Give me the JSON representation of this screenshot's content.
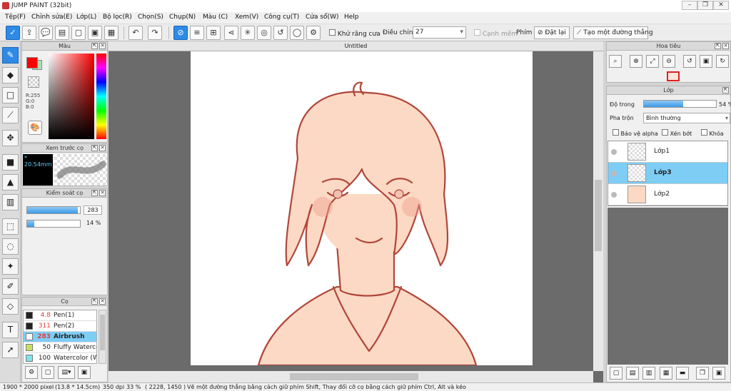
{
  "app": {
    "title": "JUMP PAINT (32bit)"
  },
  "menu": [
    "Tệp(F)",
    "Chỉnh sửa(E)",
    "Lớp(L)",
    "Bộ lọc(R)",
    "Chọn(S)",
    "Chụp(N)",
    "Màu (C)",
    "Xem(V)",
    "Công cụ(T)",
    "Cửa sổ(W)",
    "Help"
  ],
  "toolbar": {
    "antialias_label": "Khử răng cưa",
    "correction_label": "Điều chỉnh",
    "correction_value": "27",
    "edge_label": "Cạnh mềm",
    "pen_label": "Phím",
    "reset_label": "Đặt lại",
    "line_label": "Tạo một đường thẳng"
  },
  "color_panel": {
    "title": "Màu",
    "rgb": [
      "R:255",
      "G:0",
      "B:0"
    ],
    "primary": "#ff0000",
    "secondary": "#a8e0b4"
  },
  "brush_preview": {
    "title": "Xem trước cọ",
    "size": "* 20.54mm"
  },
  "brush_control": {
    "title": "Kiểm soát cọ",
    "size_value": "283",
    "size_fill": 0.96,
    "opacity_value": "14 %",
    "opacity_fill": 0.14
  },
  "brushes": {
    "title": "Cọ",
    "items": [
      {
        "size": "4.8",
        "name": "Pen(1)",
        "color": "#222222"
      },
      {
        "size": "311",
        "name": "Pen(2)",
        "color": "#222222"
      },
      {
        "size": "283",
        "name": "Airbrush",
        "color": "#ffffff",
        "selected": true
      },
      {
        "size": "50",
        "name": "Fluffy Watercolor",
        "color": "#c8e060"
      },
      {
        "size": "100",
        "name": "Watercolor (W",
        "color": "#7ee4f0"
      }
    ]
  },
  "document": {
    "tab": "Untitled"
  },
  "navigator": {
    "title": "Hoa tiêu"
  },
  "layers": {
    "title": "Lớp",
    "opacity_label": "Độ trong",
    "opacity_value": "54 %",
    "opacity_fill": 0.54,
    "blend_label": "Pha trộn",
    "blend_value": "Bình thường",
    "protect_alpha": "Bảo vệ alpha",
    "clip": "Xén bớt",
    "lock": "Khóa",
    "items": [
      {
        "name": "Lớp1"
      },
      {
        "name": "Lớp3",
        "selected": true
      },
      {
        "name": "Lớp2"
      }
    ]
  },
  "status": {
    "size": "1900 * 2000 pixel",
    "physical": "(13.8 * 14.5cm)",
    "dpi": "350 dpi",
    "zoom": "33 %",
    "coords": "( 2228, 1450 )",
    "hint": "Vẽ một đường thẳng bằng cách giữ phím Shift, Thay đổi cỡ cọ bằng cách giữ phím Ctrl, Alt và kéo"
  }
}
